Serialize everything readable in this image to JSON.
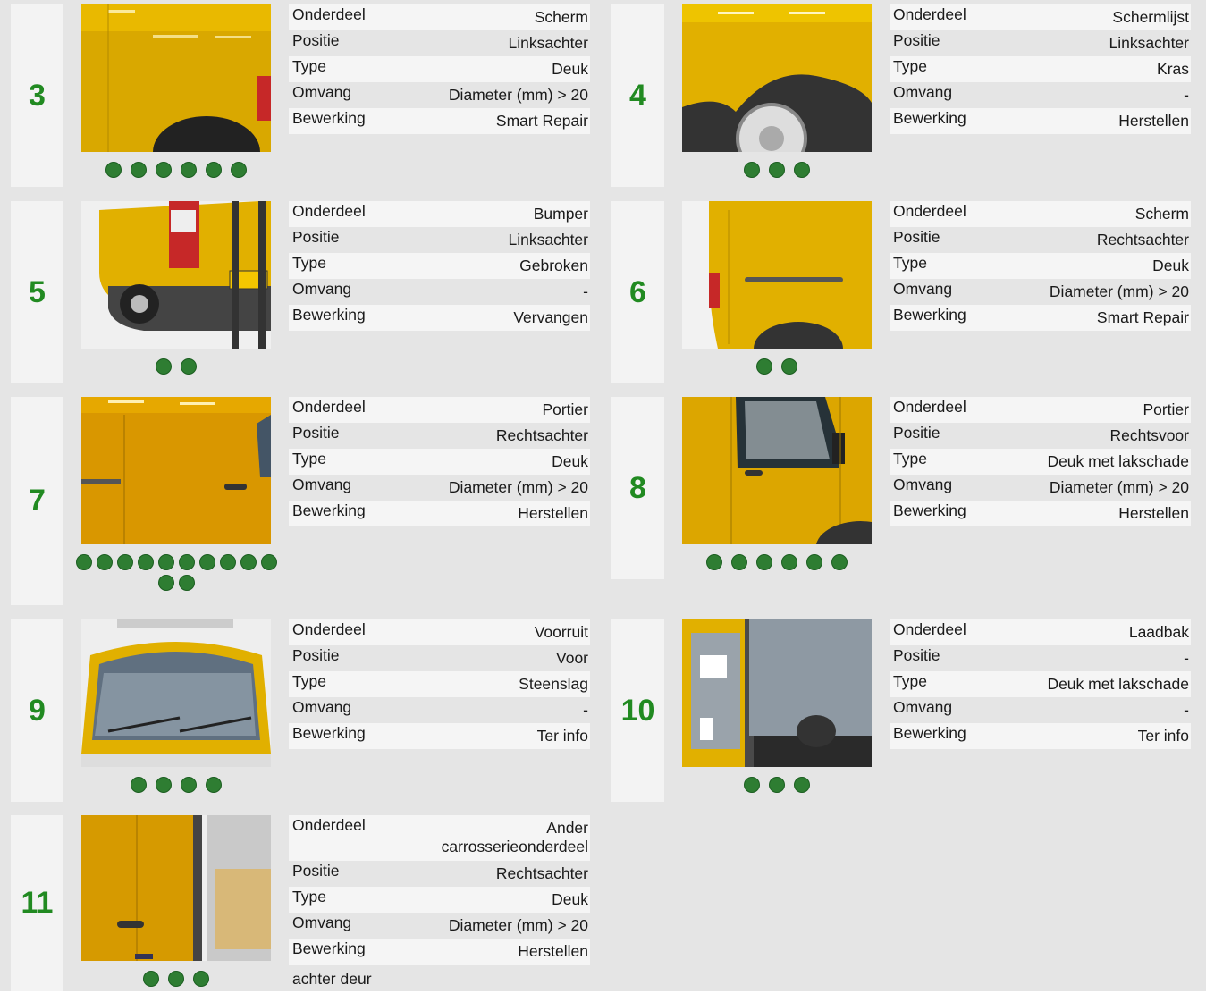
{
  "labels": {
    "onderdeel": "Onderdeel",
    "positie": "Positie",
    "type": "Type",
    "omvang": "Omvang",
    "bewerking": "Bewerking"
  },
  "colors": {
    "number": "#218a21",
    "dot": "#2e7d32",
    "panel": "#f3f3f3",
    "bg": "#e5e5e5"
  },
  "cards": [
    {
      "number": "3",
      "onderdeel": "Scherm",
      "positie": "Linksachter",
      "type": "Deuk",
      "omvang": "Diameter (mm) > 20",
      "bewerking": "Smart Repair",
      "photos": 6
    },
    {
      "number": "4",
      "onderdeel": "Schermlijst",
      "positie": "Linksachter",
      "type": "Kras",
      "omvang": "-",
      "bewerking": "Herstellen",
      "photos": 3
    },
    {
      "number": "5",
      "onderdeel": "Bumper",
      "positie": "Linksachter",
      "type": "Gebroken",
      "omvang": "-",
      "bewerking": "Vervangen",
      "photos": 2
    },
    {
      "number": "6",
      "onderdeel": "Scherm",
      "positie": "Rechtsachter",
      "type": "Deuk",
      "omvang": "Diameter (mm) > 20",
      "bewerking": "Smart Repair",
      "photos": 2
    },
    {
      "number": "7",
      "onderdeel": "Portier",
      "positie": "Rechtsachter",
      "type": "Deuk",
      "omvang": "Diameter (mm) > 20",
      "bewerking": "Herstellen",
      "photos": 12
    },
    {
      "number": "8",
      "onderdeel": "Portier",
      "positie": "Rechtsvoor",
      "type": "Deuk met lakschade",
      "omvang": "Diameter (mm) > 20",
      "bewerking": "Herstellen",
      "photos": 6
    },
    {
      "number": "9",
      "onderdeel": "Voorruit",
      "positie": "Voor",
      "type": "Steenslag",
      "omvang": "-",
      "bewerking": "Ter info",
      "photos": 4
    },
    {
      "number": "10",
      "onderdeel": "Laadbak",
      "positie": "-",
      "type": "Deuk met lakschade",
      "omvang": "-",
      "bewerking": "Ter info",
      "photos": 3
    },
    {
      "number": "11",
      "onderdeel": "Ander carrosserieonderdeel",
      "positie": "Rechtsachter",
      "type": "Deuk",
      "omvang": "Diameter (mm) > 20",
      "bewerking": "Herstellen",
      "photos": 3,
      "note": "achter deur"
    }
  ]
}
